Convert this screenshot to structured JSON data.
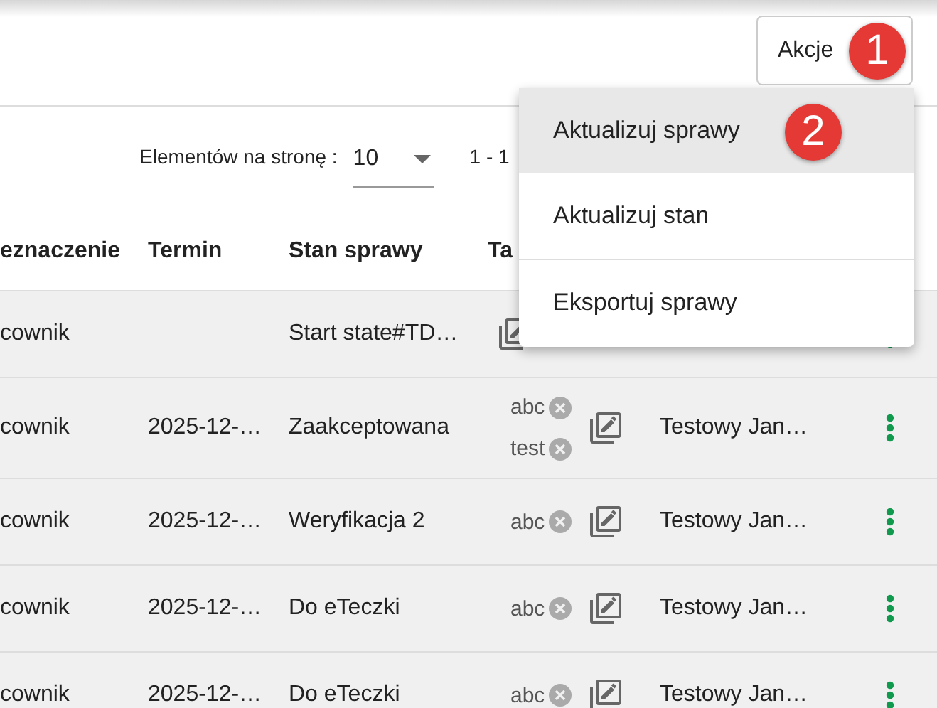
{
  "header": {
    "actions_button": "Akcje"
  },
  "paginator": {
    "label": "Elementów na stronę :",
    "page_size": "10",
    "range": "1 - 1"
  },
  "table": {
    "columns": [
      "eznaczenie",
      "Termin",
      "Stan sprawy",
      "Ta"
    ],
    "rows": [
      {
        "column_1": "cownik",
        "state": "Start state#TD…",
        "tags": []
      },
      {
        "column_1": "cownik",
        "deadline": "2025-12-…",
        "state": "Zaakceptowana",
        "tags": [
          "abc",
          "test"
        ],
        "assignee": "Testowy Jan…"
      },
      {
        "column_1": "cownik",
        "deadline": "2025-12-…",
        "state": "Weryfikacja 2",
        "tags": [
          "abc"
        ],
        "assignee": "Testowy Jan…"
      },
      {
        "column_1": "cownik",
        "deadline": "2025-12-…",
        "state": "Do eTeczki",
        "tags": [
          "abc"
        ],
        "assignee": "Testowy Jan…"
      },
      {
        "column_1": "cownik",
        "deadline": "2025-12-…",
        "state": "Do eTeczki",
        "tags": [
          "abc"
        ],
        "assignee": "Testowy Jan…"
      }
    ]
  },
  "menu": {
    "items": [
      {
        "label": "Aktualizuj sprawy",
        "highlighted": true,
        "divider_above": false
      },
      {
        "label": "Aktualizuj stan",
        "highlighted": false,
        "divider_above": false
      },
      {
        "label": "Eksportuj sprawy",
        "highlighted": false,
        "divider_above": true
      }
    ]
  },
  "annotations": [
    {
      "label": "1"
    },
    {
      "label": "2"
    }
  ]
}
